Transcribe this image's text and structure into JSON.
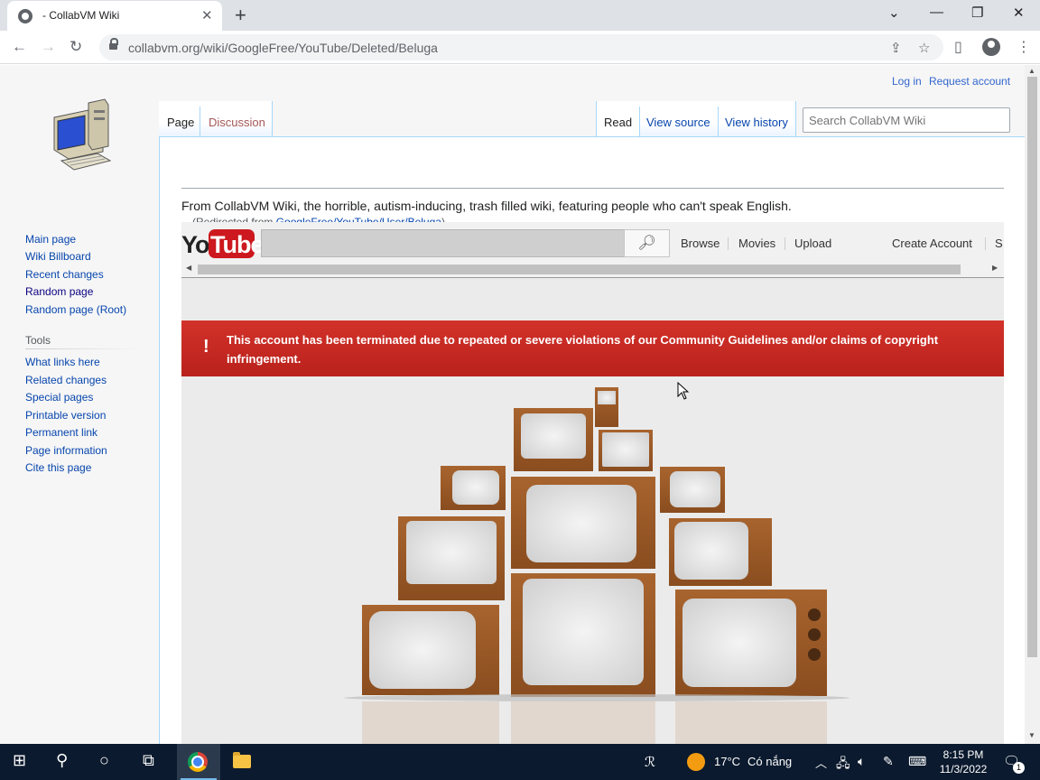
{
  "browser": {
    "tab_title": "- CollabVM Wiki",
    "url": "collabvm.org/wiki/GoogleFree/YouTube/Deleted/Beluga"
  },
  "wiki": {
    "personal": {
      "login": "Log in",
      "request": "Request account"
    },
    "tabs": {
      "page": "Page",
      "discussion": "Discussion",
      "read": "Read",
      "view_source": "View source",
      "view_history": "View history"
    },
    "search_placeholder": "Search CollabVM Wiki",
    "nav": [
      "Main page",
      "Wiki Billboard",
      "Recent changes",
      "Random page",
      "Random page (Root)"
    ],
    "tools_heading": "Tools",
    "tools": [
      "What links here",
      "Related changes",
      "Special pages",
      "Printable version",
      "Permanent link",
      "Page information",
      "Cite this page"
    ],
    "site_sub": "From CollabVM Wiki, the horrible, autism-inducing, trash filled wiki, featuring people who can't speak English.",
    "redirect_prefix": "(Redirected from",
    "redirect_link": "GoogleFree/YouTube/User/Beluga",
    "redirect_suffix": ")"
  },
  "youtube": {
    "logo_you": "You",
    "logo_tube": "Tube",
    "nav": {
      "browse": "Browse",
      "movies": "Movies",
      "upload": "Upload",
      "create_account": "Create Account",
      "sign_in_partial": "S"
    },
    "alert_icon": "!",
    "alert_message": "This account has been terminated due to repeated or severe violations of our Community Guidelines and/or claims of copyright infringement."
  },
  "taskbar": {
    "temperature": "17°C",
    "weather": "Có nắng",
    "time": "8:15 PM",
    "date": "11/3/2022",
    "notifications": "1"
  },
  "colors": {
    "link": "#0645ad",
    "alert_red": "#c8271c",
    "youtube_red": "#cc181e",
    "taskbar": "#0b1a2e"
  }
}
